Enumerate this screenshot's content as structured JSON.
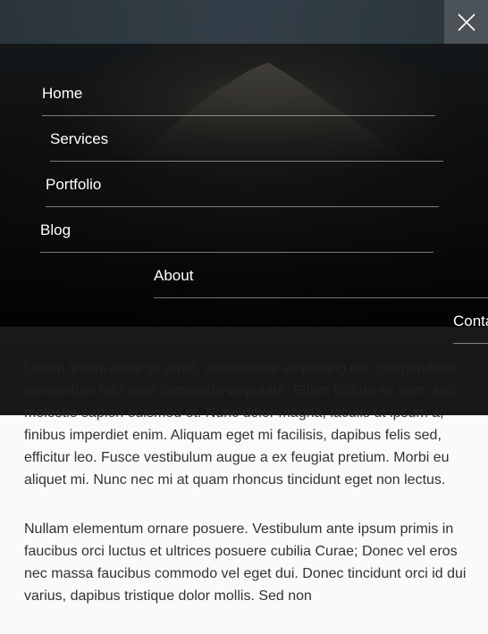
{
  "menu": {
    "items": [
      {
        "label": "Home"
      },
      {
        "label": "Services"
      },
      {
        "label": "Portfolio"
      },
      {
        "label": "Blog"
      },
      {
        "label": "About"
      },
      {
        "label": "Conta"
      }
    ],
    "close_icon": "close-icon"
  },
  "article": {
    "paragraphs": [
      "Lorem ipsum dolor sit amet, consectetur adipiscing elit. Suspendisse elementum felis eget commodo vulputate. Etiam finibus ex sem, sed molestie sapien euismod et. Nunc dolor magna, iaculis ut ipsum a, finibus imperdiet enim. Aliquam eget mi facilisis, dapibus felis sed, efficitur leo. Fusce vestibulum augue a ex feugiat pretium. Morbi eu aliquet mi. Nunc nec mi at quam rhoncus tincidunt eget non lectus.",
      "Nullam elementum ornare posuere. Vestibulum ante ipsum primis in faucibus orci luctus et ultrices posuere cubilia Curae; Donec vel eros nec massa faucibus commodo vel eget dui. Donec tincidunt orci id dui varius, dapibus tristique dolor mollis. Sed non"
    ]
  },
  "colors": {
    "overlay": "#000000",
    "close_bg": "#4c5358",
    "text": "#333333",
    "menu_text": "#ffffff"
  }
}
